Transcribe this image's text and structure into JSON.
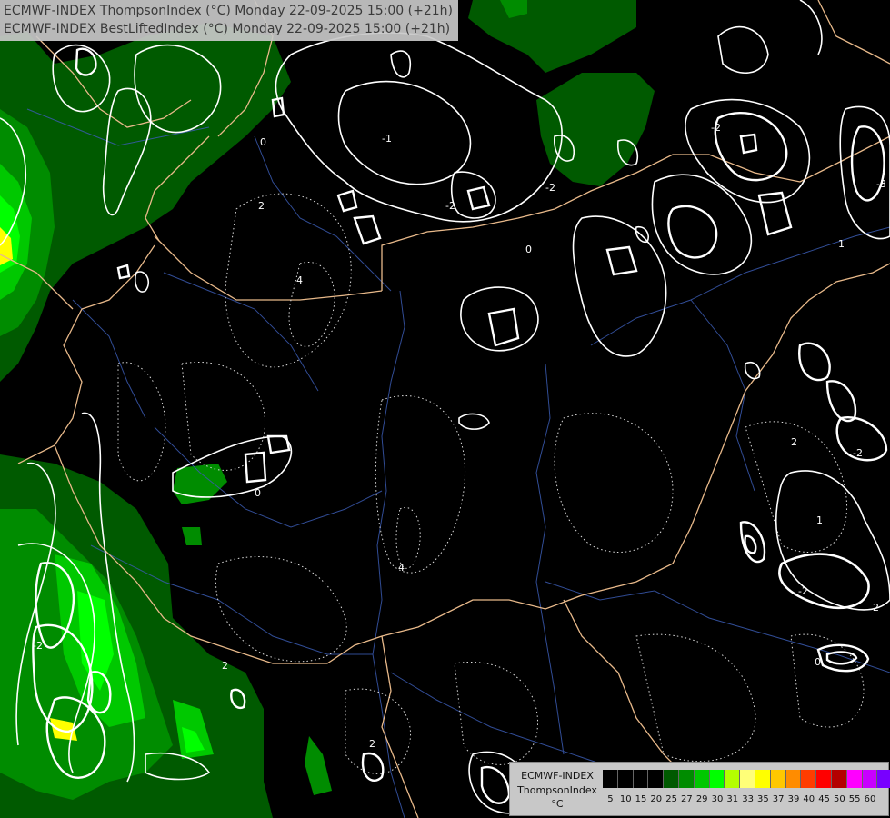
{
  "title": {
    "line1": "ECMWF-INDEX ThompsonIndex (°C) Monday 22-09-2025 15:00 (+21h)",
    "line2": "ECMWF-INDEX BestLiftedIndex (°C) Monday 22-09-2025 15:00 (+21h)"
  },
  "legend": {
    "model": "ECMWF-INDEX",
    "variable": "ThompsonIndex",
    "unit": "°C",
    "bins": [
      {
        "label": "5",
        "color": "#000000"
      },
      {
        "label": "10",
        "color": "#000000"
      },
      {
        "label": "15",
        "color": "#000000"
      },
      {
        "label": "20",
        "color": "#000000"
      },
      {
        "label": "25",
        "color": "#005a00"
      },
      {
        "label": "27",
        "color": "#008c00"
      },
      {
        "label": "29",
        "color": "#00c800"
      },
      {
        "label": "30",
        "color": "#00ff00"
      },
      {
        "label": "31",
        "color": "#b4ff00"
      },
      {
        "label": "33",
        "color": "#ffff78"
      },
      {
        "label": "35",
        "color": "#ffff00"
      },
      {
        "label": "37",
        "color": "#ffc800"
      },
      {
        "label": "39",
        "color": "#ff8c00"
      },
      {
        "label": "40",
        "color": "#ff3c00"
      },
      {
        "label": "45",
        "color": "#ff0000"
      },
      {
        "label": "50",
        "color": "#b40000"
      },
      {
        "label": "55",
        "color": "#ff00ff"
      },
      {
        "label": "60",
        "color": "#c800ff"
      },
      {
        "label": "",
        "color": "#7800ff"
      },
      {
        "label": "",
        "color": "#0000ff"
      }
    ]
  },
  "contour_labels": [
    "0",
    "-2",
    "2",
    "4",
    "-3",
    "-1",
    "1"
  ]
}
